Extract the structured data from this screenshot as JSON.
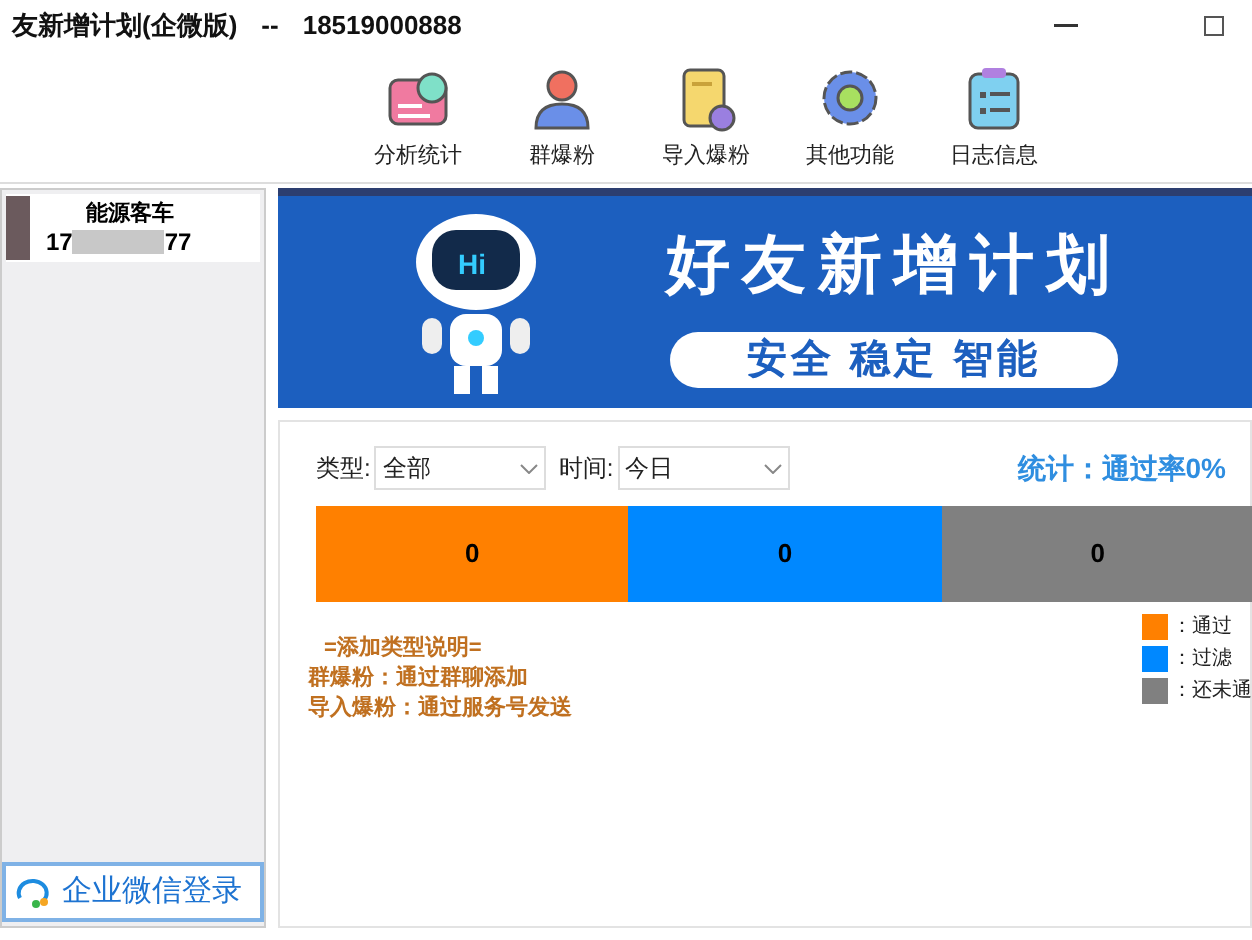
{
  "window": {
    "title": "友新增计划(企微版)",
    "separator": "--",
    "phone": "18519000888"
  },
  "toolbar": [
    {
      "label": "分析统计",
      "kind": "chart"
    },
    {
      "label": "群爆粉",
      "kind": "user"
    },
    {
      "label": "导入爆粉",
      "kind": "doc"
    },
    {
      "label": "其他功能",
      "kind": "gear"
    },
    {
      "label": "日志信息",
      "kind": "clipboard"
    }
  ],
  "account": {
    "name": "能源客车",
    "phone_start": "17",
    "phone_end": "77"
  },
  "login_button": "企业微信登录",
  "banner": {
    "title": "好友新增计划",
    "subtitle": "安全 稳定 智能",
    "robot_text": "Hi"
  },
  "filters": [
    {
      "label": "类型:",
      "value": "全部"
    },
    {
      "label": "时间:",
      "value": "今日"
    }
  ],
  "summary": "统计：通过率0%",
  "segments": [
    {
      "value": "0",
      "color": "#ff8000"
    },
    {
      "value": "0",
      "color": "#0088ff"
    },
    {
      "value": "0",
      "color": "#808080"
    }
  ],
  "notes": [
    "=添加类型说明=",
    "群爆粉：通过群聊添加",
    "导入爆粉：通过服务号发送"
  ],
  "legend": [
    {
      "label": "：通过",
      "color": "#ff8000"
    },
    {
      "label": "：过滤",
      "color": "#0088ff"
    },
    {
      "label": "：还未通",
      "color": "#808080"
    }
  ]
}
